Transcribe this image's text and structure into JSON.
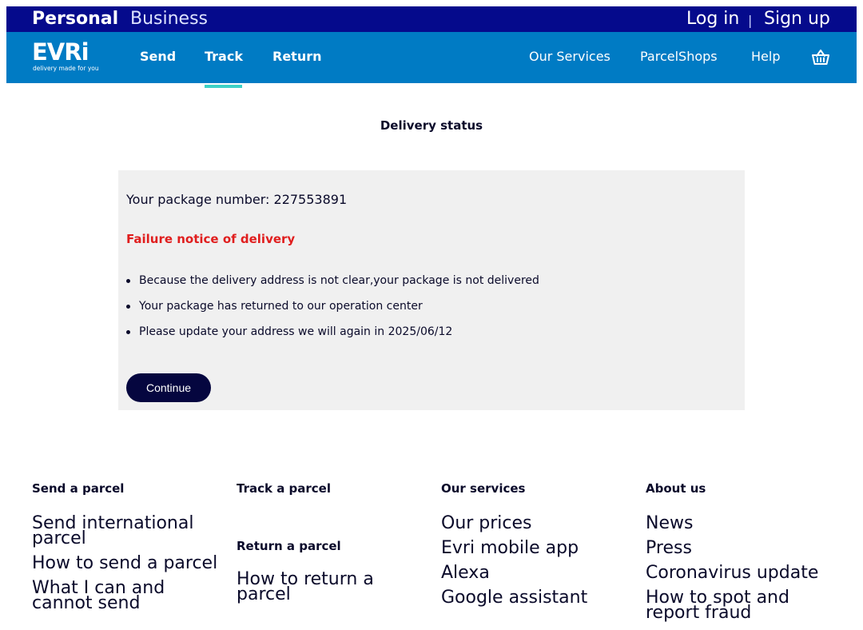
{
  "topbar": {
    "personal": "Personal",
    "business": "Business",
    "login": "Log in",
    "divider": "|",
    "signup": "Sign up"
  },
  "brand": {
    "name": "EVRi",
    "tagline": "delivery made for you"
  },
  "nav": {
    "left": [
      "Send",
      "Track",
      "Return"
    ],
    "active": "Track",
    "right": [
      "Our Services",
      "ParcelShops",
      "Help"
    ],
    "basket_icon": "basket-icon"
  },
  "status": {
    "heading": "Delivery status",
    "package_line": "Your package number: 227553891",
    "failure": "Failure notice of delivery",
    "bullets": [
      "Because the delivery address is not clear,your package is not delivered",
      "Your package has returned to our operation center",
      "Please update your address we will again in 2025/06/12"
    ],
    "continue": "Continue"
  },
  "footer": {
    "send": {
      "heading": "Send a parcel",
      "links": [
        "Send international parcel",
        "How to send a parcel",
        "What I can and cannot send"
      ]
    },
    "track": {
      "heading": "Track a parcel"
    },
    "return": {
      "heading": "Return a parcel",
      "links": [
        "How to return a parcel"
      ]
    },
    "services": {
      "heading": "Our services",
      "links": [
        "Our prices",
        "Evri mobile app",
        "Alexa",
        "Google assistant"
      ]
    },
    "about": {
      "heading": "About us",
      "links": [
        "News",
        "Press",
        "Coronavirus update",
        "How to spot and report fraud"
      ]
    }
  },
  "colors": {
    "topbar": "#050a8c",
    "navbar": "#007bc4",
    "active_underline": "#3dd1c6",
    "failure_red": "#e01e1e",
    "button": "#05063f",
    "panel": "#f0f0f0"
  }
}
